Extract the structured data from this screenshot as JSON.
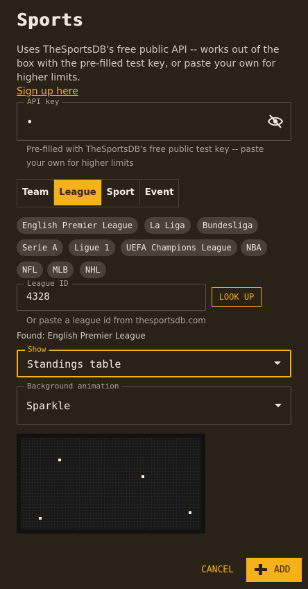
{
  "title": "Sports",
  "description": "Uses TheSportsDB's free public API -- works out of the box with the pre-filled test key, or paste your own for higher limits.",
  "signup_link": "Sign up here",
  "api_key": {
    "label": "API key",
    "value": "•",
    "helper": "Pre-filled with TheSportsDB's free public test key -- paste your own for higher limits",
    "toggle_icon": "eye-off-icon"
  },
  "tabs": [
    {
      "label": "Team",
      "active": false
    },
    {
      "label": "League",
      "active": true
    },
    {
      "label": "Sport",
      "active": false
    },
    {
      "label": "Event",
      "active": false
    }
  ],
  "chips": [
    "English Premier League",
    "La Liga",
    "Bundesliga",
    "Serie A",
    "Ligue 1",
    "UEFA Champions League",
    "NBA",
    "NFL",
    "MLB",
    "NHL"
  ],
  "league_id": {
    "label": "League ID",
    "value": "4328",
    "lookup_label": "LOOK UP",
    "helper": "Or paste a league id from thesportsdb.com"
  },
  "found_text": "Found: English Premier League",
  "show_select": {
    "label": "Show",
    "value": "Standings table"
  },
  "animation_select": {
    "label": "Background animation",
    "value": "Sparkle"
  },
  "actions": {
    "cancel": "CANCEL",
    "add": "ADD"
  },
  "colors": {
    "accent": "#f5b118",
    "background": "#2b2217",
    "chip": "#4a4238"
  }
}
